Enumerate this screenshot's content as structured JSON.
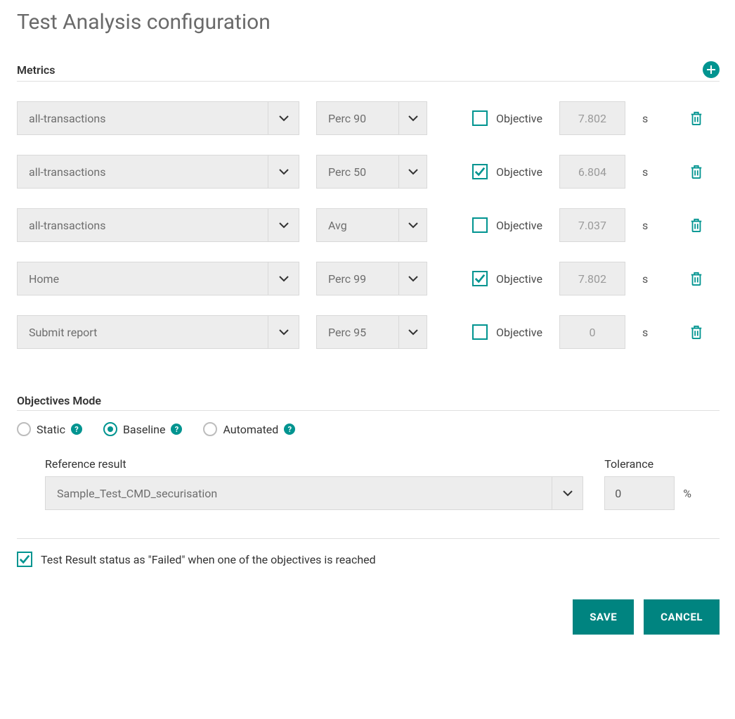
{
  "title": "Test Analysis configuration",
  "metrics_label": "Metrics",
  "objective_label": "Objective",
  "unit_seconds": "s",
  "metrics": [
    {
      "transaction": "all-transactions",
      "stat": "Perc 90",
      "checked": false,
      "value": "7.802"
    },
    {
      "transaction": "all-transactions",
      "stat": "Perc 50",
      "checked": true,
      "value": "6.804"
    },
    {
      "transaction": "all-transactions",
      "stat": "Avg",
      "checked": false,
      "value": "7.037"
    },
    {
      "transaction": "Home",
      "stat": "Perc 99",
      "checked": true,
      "value": "7.802"
    },
    {
      "transaction": "Submit report",
      "stat": "Perc 95",
      "checked": false,
      "value": "0"
    }
  ],
  "objectives_mode_label": "Objectives Mode",
  "modes": {
    "static": {
      "label": "Static",
      "selected": false
    },
    "baseline": {
      "label": "Baseline",
      "selected": true
    },
    "automated": {
      "label": "Automated",
      "selected": false
    }
  },
  "reference": {
    "label": "Reference result",
    "value": "Sample_Test_CMD_securisation"
  },
  "tolerance": {
    "label": "Tolerance",
    "value": "0",
    "unit": "%"
  },
  "failed_checkbox": {
    "checked": true,
    "label": "Test Result status as \"Failed\" when one of the objectives is reached"
  },
  "buttons": {
    "save": "SAVE",
    "cancel": "CANCEL"
  },
  "help_glyph": "?"
}
